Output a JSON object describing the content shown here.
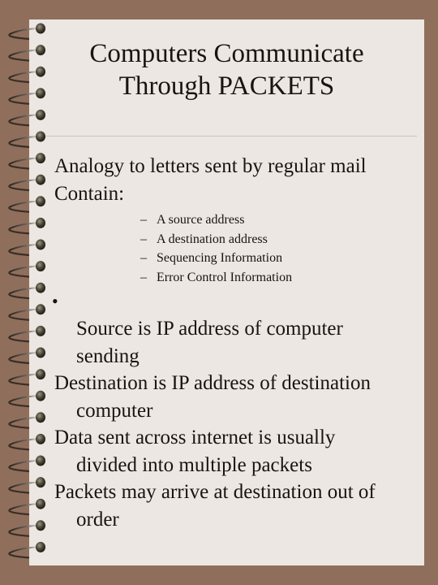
{
  "slide": {
    "title_line1": "Computers Communicate",
    "title_line2": "Through PACKETS",
    "intro": [
      "Analogy  to letters sent by regular mail",
      "Contain:"
    ],
    "contents": [
      "A source address",
      "A destination address",
      "Sequencing Information",
      "Error Control Information"
    ],
    "dash_glyph": "–",
    "bullet_glyph": "•",
    "points": [
      {
        "first": "Source is IP address of computer",
        "cont": "sending",
        "first_indented": true
      },
      {
        "first": "Destination is IP address of destination",
        "cont": "computer",
        "first_indented": false
      },
      {
        "first": "Data sent across internet is usually",
        "cont": "divided into multiple packets",
        "first_indented": false
      },
      {
        "first": "Packets may arrive at destination out of",
        "cont": "order",
        "first_indented": false
      }
    ]
  },
  "colors": {
    "background": "#8f6f5c",
    "paper": "#ece7e3",
    "divider": "#cfc5b8",
    "text": "#1a1410"
  }
}
